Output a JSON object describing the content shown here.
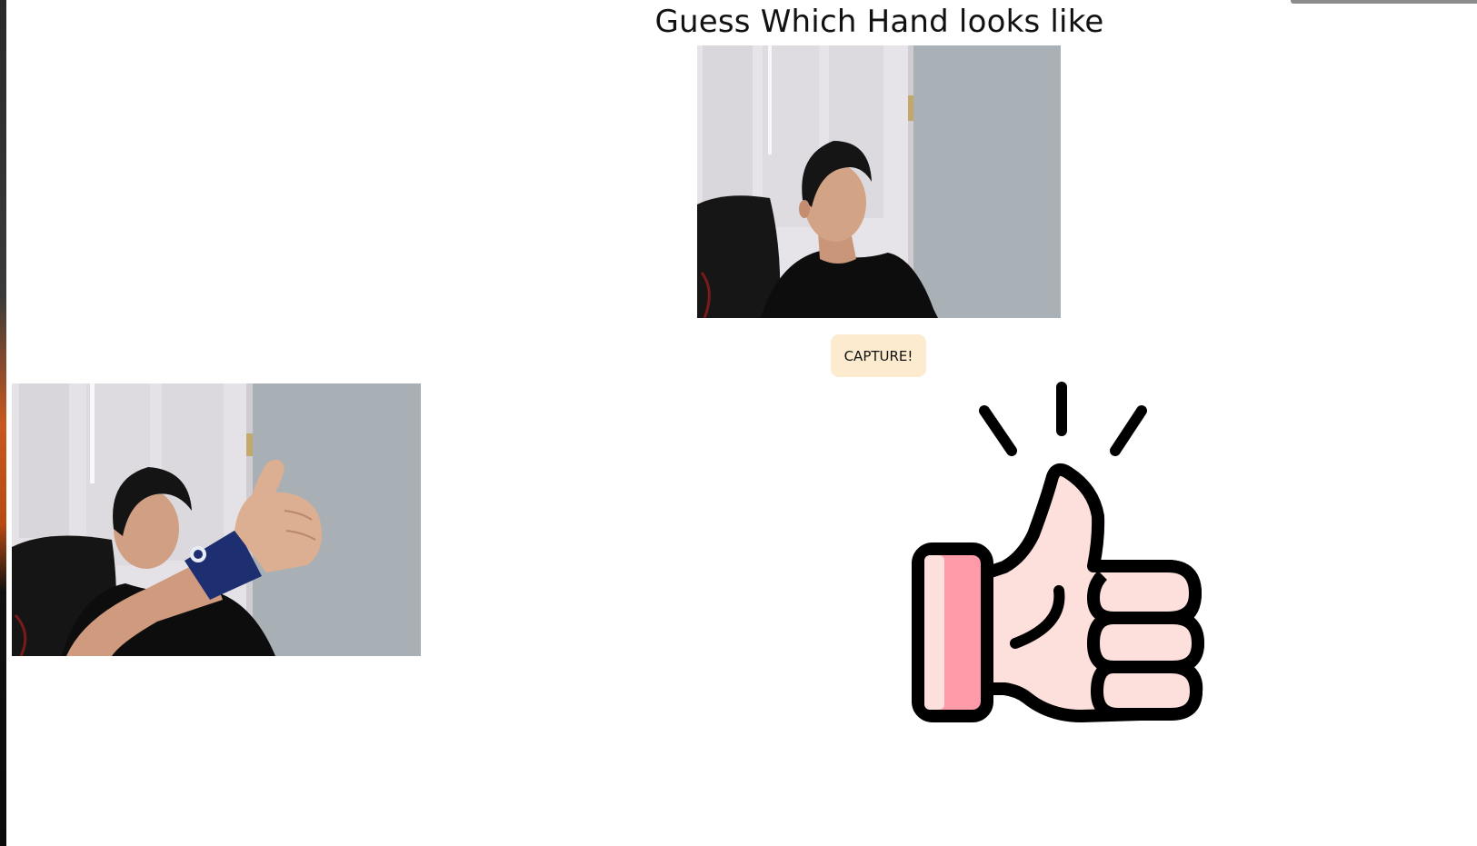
{
  "page": {
    "title": "Guess Which Hand looks like"
  },
  "controls": {
    "capture_label": "CAPTURE!"
  },
  "icons": {
    "result": "thumbs-up-icon"
  },
  "colors": {
    "button_bg": "#fdebd0",
    "thumb_skin": "#fde0dc",
    "cuff_pink": "#ff9aa8",
    "wall_gray": "#a7b0b6",
    "door_white": "#e4e2e6",
    "shirt_black": "#0e0e0e",
    "wristband_navy": "#1c2f6e"
  }
}
